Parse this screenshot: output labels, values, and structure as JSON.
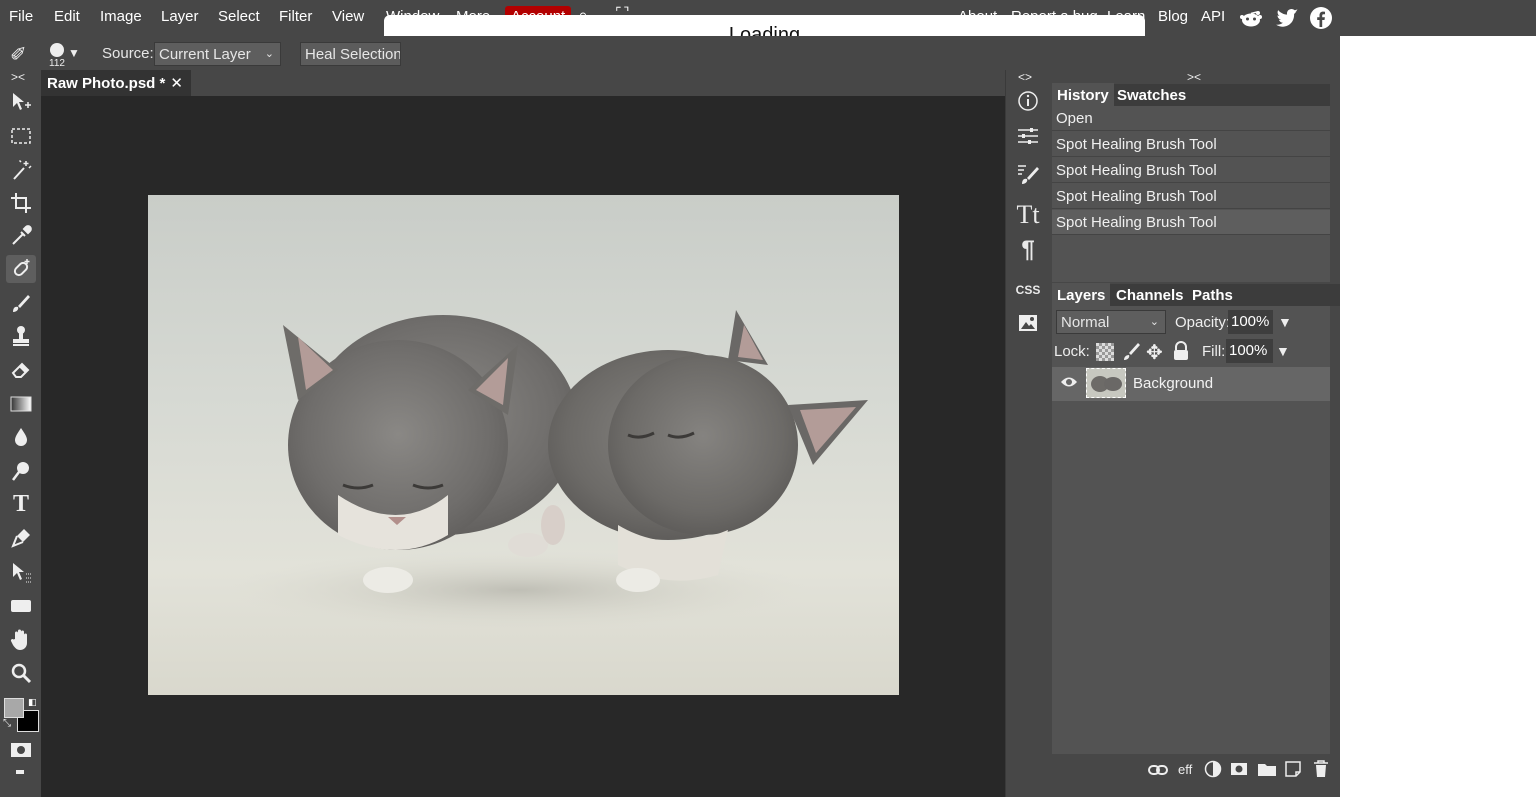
{
  "menubar": {
    "items": [
      "File",
      "Edit",
      "Image",
      "Layer",
      "Select",
      "Filter",
      "View",
      "Window",
      "More"
    ],
    "account_label": "Account",
    "right_links": [
      "About",
      "Report a bug",
      "Learn",
      "Blog",
      "API"
    ],
    "social_icons": [
      "reddit-icon",
      "twitter-icon",
      "facebook-icon"
    ]
  },
  "loading": {
    "text": "Loading"
  },
  "options": {
    "brush_size": "112",
    "source_label": "Source:",
    "source_value": "Current Layer",
    "heal_button": "Heal Selection"
  },
  "document": {
    "tab_title": "Raw Photo.psd *",
    "close": "✕"
  },
  "toolbar": {
    "tools": [
      "move-tool",
      "marquee-tool",
      "magic-wand-tool",
      "crop-tool",
      "eyedropper-tool",
      "spot-healing-tool",
      "brush-tool",
      "stamp-tool",
      "eraser-tool",
      "gradient-tool",
      "blur-tool",
      "dodge-tool",
      "type-tool",
      "pen-tool",
      "path-select-tool",
      "shape-tool",
      "hand-tool",
      "zoom-tool"
    ]
  },
  "side_icons": [
    "info-icon",
    "adjustments-icon",
    "brush-settings-icon",
    "character-icon",
    "paragraph-icon",
    "css-icon",
    "image-icon"
  ],
  "history_panel": {
    "tabs": [
      "History",
      "Swatches"
    ],
    "rows": [
      "Open",
      "Spot Healing Brush Tool",
      "Spot Healing Brush Tool",
      "Spot Healing Brush Tool",
      "Spot Healing Brush Tool"
    ]
  },
  "layers_panel": {
    "tabs": [
      "Layers",
      "Channels",
      "Paths"
    ],
    "blend_mode": "Normal",
    "opacity_label": "Opacity:",
    "opacity_value": "100%",
    "lock_label": "Lock:",
    "fill_label": "Fill:",
    "fill_value": "100%",
    "layers": [
      {
        "name": "Background",
        "visible": true
      }
    ],
    "footer": [
      "link-icon",
      "eff",
      "adjustment-icon",
      "mask-icon",
      "folder-icon",
      "new-layer-icon",
      "trash-icon"
    ]
  },
  "colors": {
    "background": "#474747",
    "canvas": "#282828",
    "account": "#b30000",
    "panel_row": "#535353"
  }
}
